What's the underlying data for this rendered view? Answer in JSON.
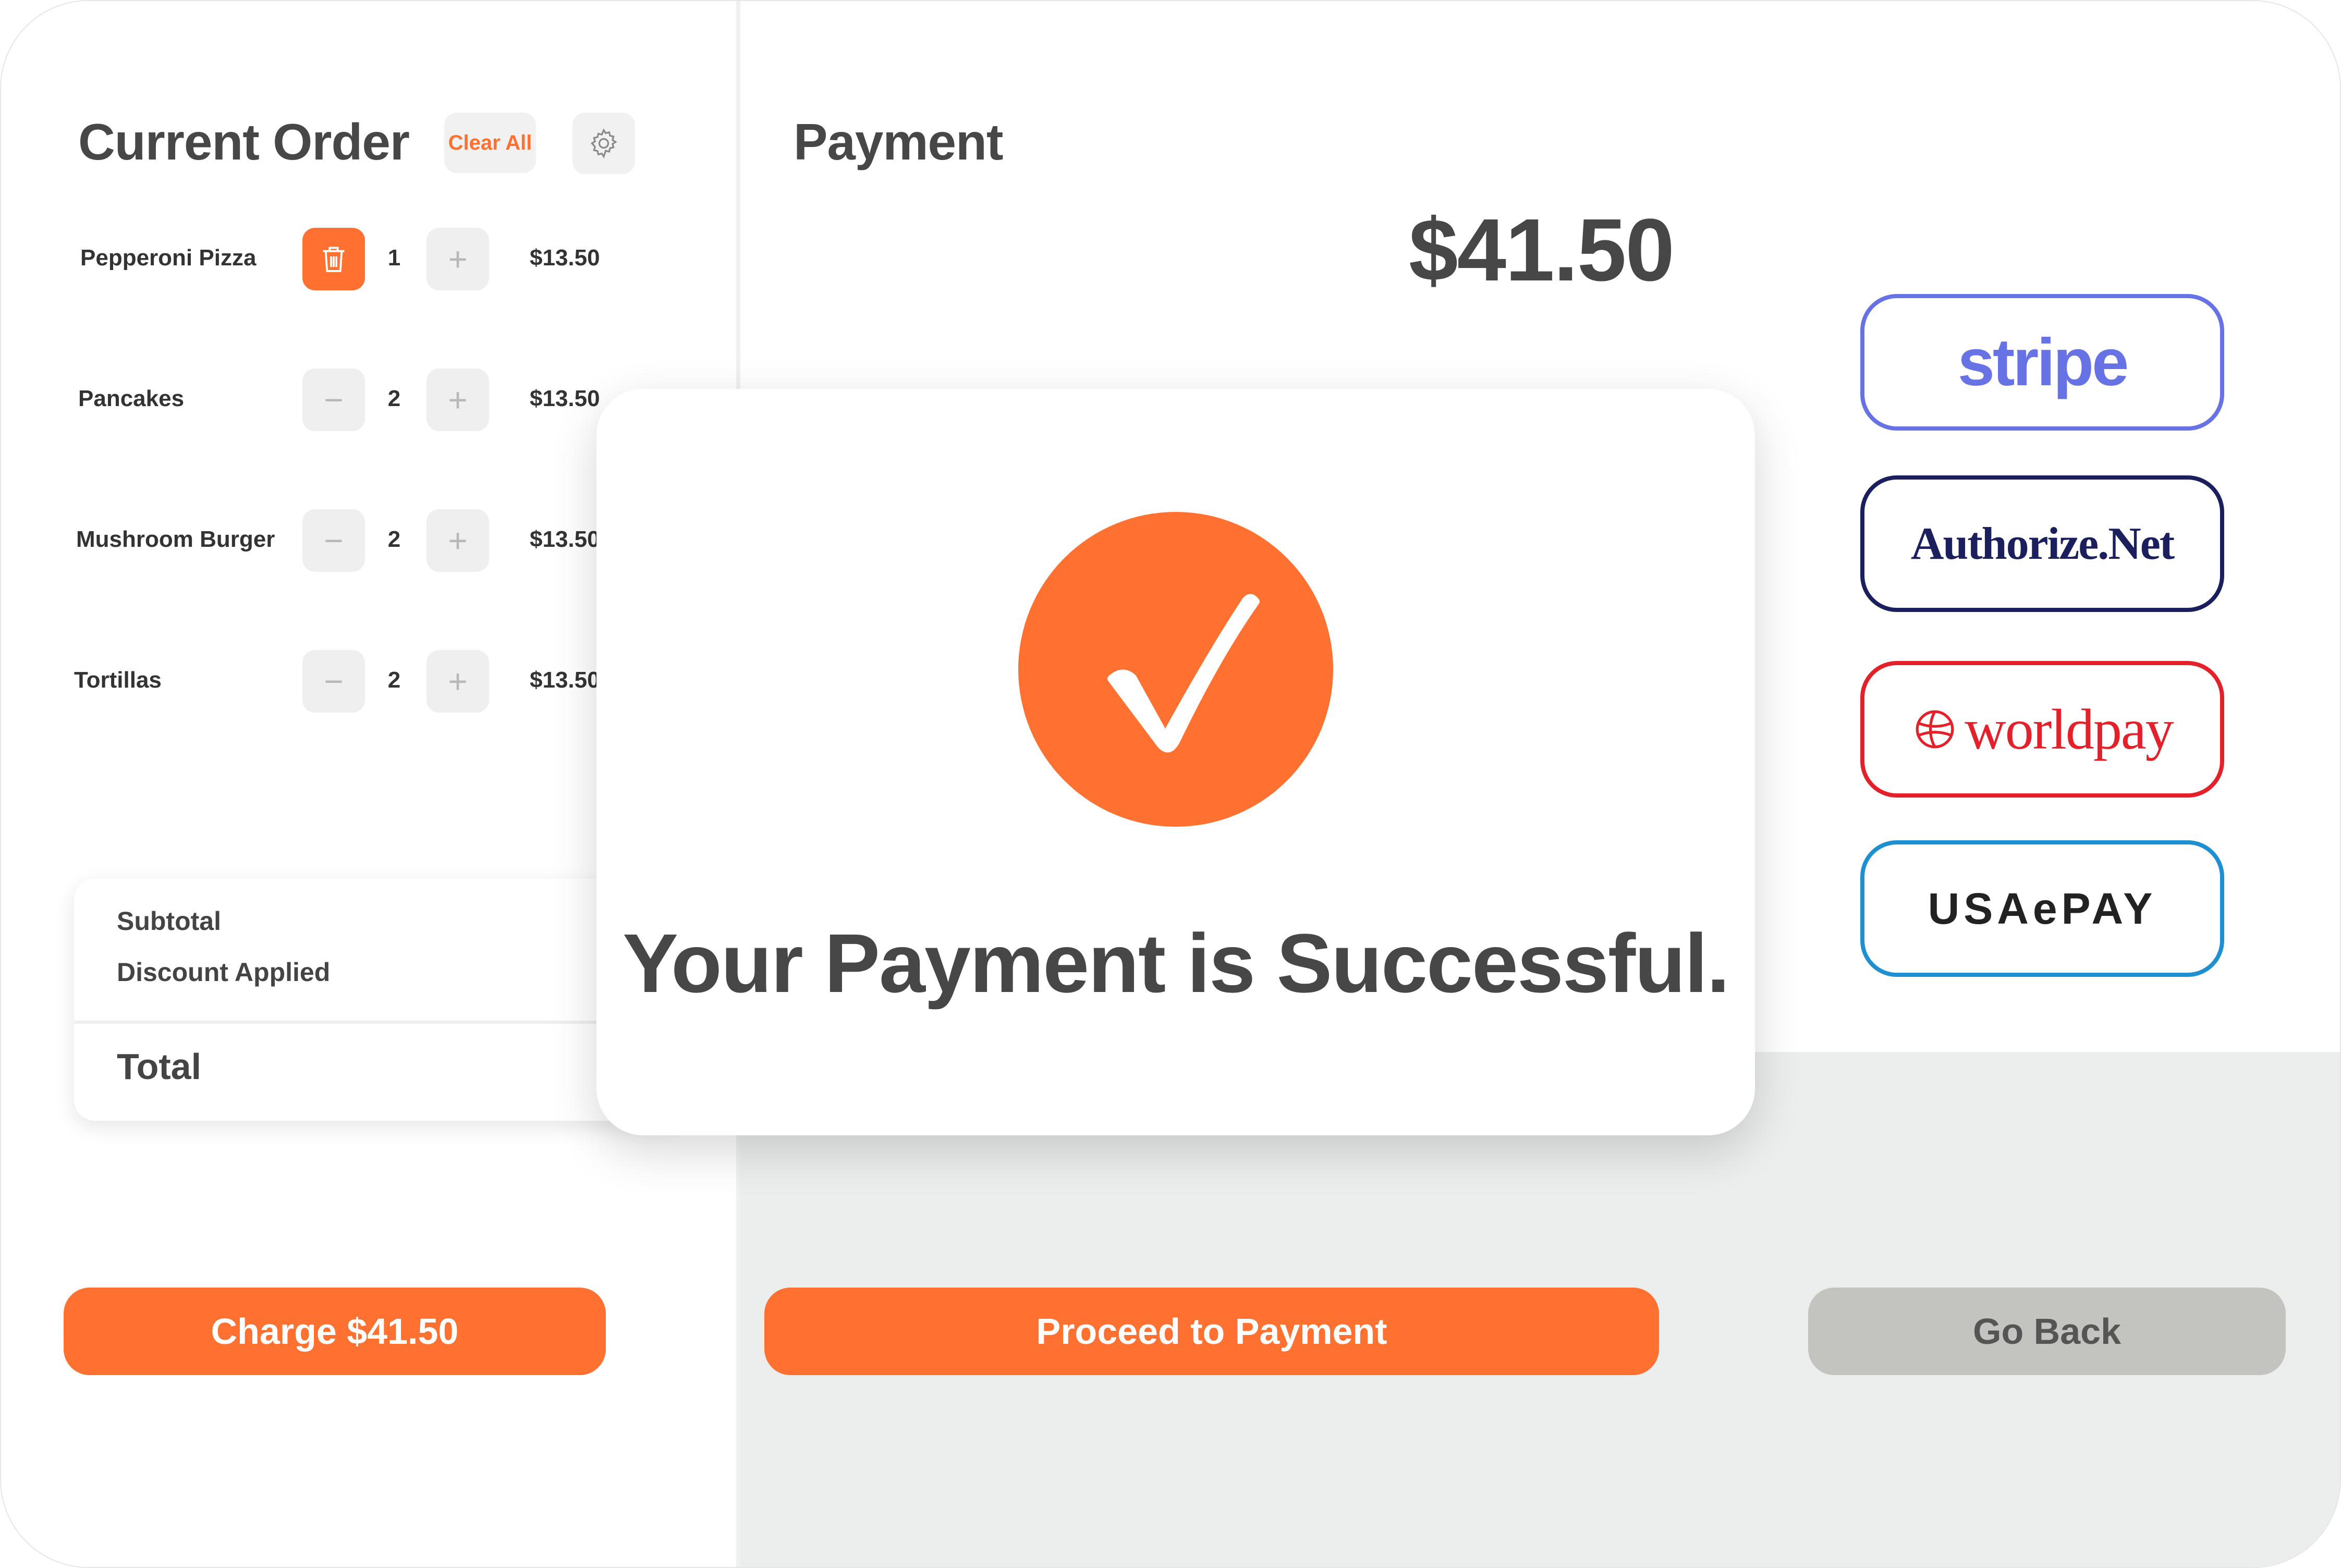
{
  "order": {
    "title": "Current Order",
    "clear_all_label": "Clear All",
    "settings_icon": "gear-icon",
    "items": [
      {
        "name": "Pepperoni Pizza",
        "qty": "1",
        "price": "$13.50"
      },
      {
        "name": "Pancakes",
        "qty": "2",
        "price": "$13.50"
      },
      {
        "name": "Mushroom Burger",
        "qty": "2",
        "price": "$13.50"
      },
      {
        "name": "Tortillas",
        "qty": "2",
        "price": "$13.50"
      }
    ],
    "summary": {
      "subtotal_label": "Subtotal",
      "discount_label": "Discount Applied",
      "total_label": "Total"
    },
    "charge_label": "Charge $41.50"
  },
  "payment": {
    "title": "Payment",
    "amount": "$41.50",
    "gateways": [
      {
        "name": "stripe",
        "color": "#6772e5"
      },
      {
        "name": "Authorize.Net",
        "color": "#1b1f5e"
      },
      {
        "name": "worldpay",
        "color": "#e4202a"
      },
      {
        "name": "USAePAY",
        "color": "#1e8fd1"
      }
    ],
    "proceed_label": "Proceed to Payment",
    "back_label": "Go Back"
  },
  "modal": {
    "message": "Your Payment is Successful.",
    "icon": "checkmark-icon"
  },
  "colors": {
    "accent": "#ff7131",
    "text": "#474747",
    "grey_button": "#c3c3bf"
  }
}
